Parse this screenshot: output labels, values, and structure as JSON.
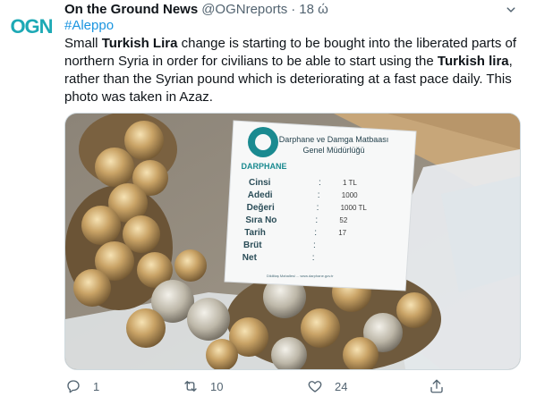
{
  "author": {
    "display_name": "On the Ground News",
    "handle": "@OGNreports",
    "separator": "·",
    "time": "18 ώ",
    "avatar_text": "OGN",
    "avatar_color": "#1da9b5"
  },
  "tweet": {
    "hashtag": "#Aleppo",
    "text_parts": [
      {
        "t": "Small ",
        "bold": false
      },
      {
        "t": "Turkish Lira",
        "bold": true
      },
      {
        "t": " change is starting to be bought into the liberated parts of northern Syria in order for civilians to be able to start using the ",
        "bold": false
      },
      {
        "t": "Turkish lira",
        "bold": true
      },
      {
        "t": ", rather than the Syrian pound which is deteriorating at a fast pace daily. This photo was taken in Azaz.",
        "bold": false
      }
    ]
  },
  "media": {
    "label": {
      "logo_text": "DARPHANE",
      "org_line1": "Darphane ve Damga Matbaası",
      "org_line2": "Genel Müdürlüğü",
      "rows": [
        {
          "key": "Cinsi",
          "sep": ":",
          "value": "1 TL"
        },
        {
          "key": "Adedi",
          "sep": ":",
          "value": "1000"
        },
        {
          "key": "Değeri",
          "sep": ":",
          "value": "1000 TL"
        },
        {
          "key": "Sıra No",
          "sep": ":",
          "value": "52"
        },
        {
          "key": "Tarih",
          "sep": ":",
          "value": "17"
        },
        {
          "key": "Brüt",
          "sep": ":",
          "value": ""
        },
        {
          "key": "Net",
          "sep": ":",
          "value": ""
        }
      ],
      "footer": "Dikilitaş Mahallesi ... www.darphane.gov.tr"
    }
  },
  "actions": {
    "reply_count": "1",
    "retweet_count": "10",
    "like_count": "24"
  },
  "icons": {
    "more": "more-icon",
    "reply": "reply-icon",
    "retweet": "retweet-icon",
    "like": "like-icon",
    "share": "share-icon"
  },
  "colors": {
    "link": "#1b95e0",
    "muted": "#536471",
    "text": "#0f1419"
  }
}
